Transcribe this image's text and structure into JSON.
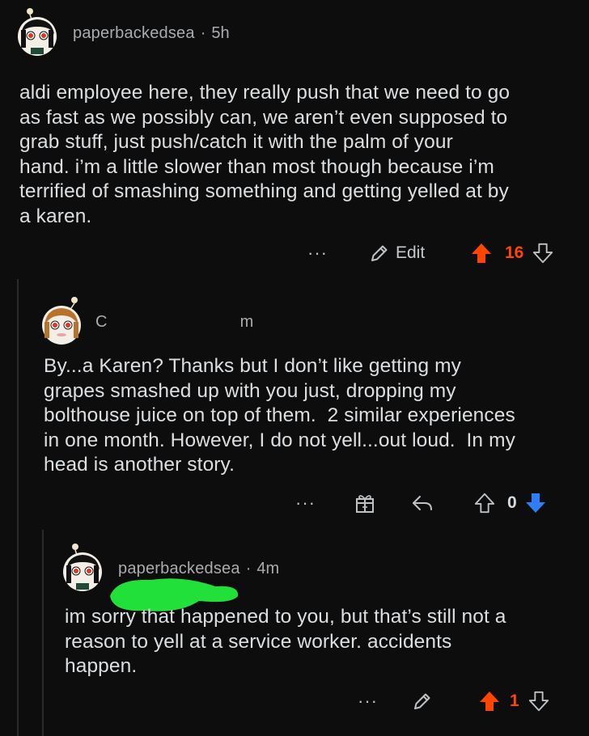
{
  "comments": [
    {
      "username": "paperbackedsea",
      "separator": "·",
      "age": "5h",
      "text": "aldi employee here, they really push that we need to go\nas fast as we possibly can, we aren’t even supposed to\ngrab stuff, just push/catch it with the palm of your\nhand. i’m a little slower than most though because i’m\nterrified of smashing something and getting yelled at by\na karen.",
      "more_label": "···",
      "edit_label": "Edit",
      "vote_count": "16",
      "upvoted": true
    },
    {
      "username_visible_prefix": "C",
      "age_visible_suffix": "m",
      "text": "By...a Karen? Thanks but I don’t like getting my\ngrapes smashed up with you just, dropping my\nbolthouse juice on top of them.  2 similar experiences\nin one month. However, I do not yell...out loud.  In my\nhead is another story.",
      "more_label": "···",
      "vote_count": "0",
      "downvoted": true
    },
    {
      "username": "paperbackedsea",
      "separator": "·",
      "age": "4m",
      "text": "im sorry that happened to you, but that’s still not a\nreason to yell at a service worker. accidents\nhappen.",
      "more_label": "···",
      "vote_count": "1",
      "upvoted": true
    }
  ],
  "colors": {
    "background": "#0d0d0e",
    "upvote": "#ff4500",
    "downvote": "#2d7ff9",
    "redaction": "#22e03a",
    "muted_text": "#a9acaf",
    "body_text": "#dcdfe2"
  },
  "icons": {
    "edit": "pencil-icon",
    "gift": "award-icon",
    "reply": "reply-arrow-icon",
    "upvote": "upvote-arrow-icon",
    "downvote": "downvote-arrow-icon"
  }
}
